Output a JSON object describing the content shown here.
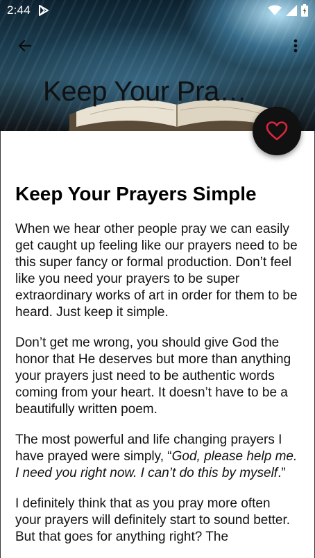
{
  "status_bar": {
    "time": "2:44"
  },
  "header": {
    "title": "Keep Your Pra…"
  },
  "article": {
    "title": "Keep Your Prayers Simple",
    "p1": "When we hear other people pray we can easily get caught up feeling like our prayers need to be this super fancy or formal production. Don’t feel like you need your prayers to be super extraordinary works of art in order for them to be heard. Just keep it simple.",
    "p2": "Don’t get me wrong, you should give God the honor that He deserves but more than anything your prayers just need to be authentic words coming from your heart. It doesn’t have to be a beautifully written poem.",
    "p3_lead": "The most powerful and life changing prayers I have prayed were simply, “",
    "p3_quote": "God, please help me. I need you right now. I can’t do this by myself",
    "p3_tail": ".”",
    "p4": "I definitely think that as you pray more often your prayers will definitely start to sound better. But that goes for anything right? The"
  },
  "colors": {
    "fab_background": "#111111",
    "heart_accent": "#d9263f"
  },
  "icons": {
    "back": "arrow-left-icon",
    "menu": "more-vertical-icon",
    "fab": "heart-outline-icon"
  }
}
